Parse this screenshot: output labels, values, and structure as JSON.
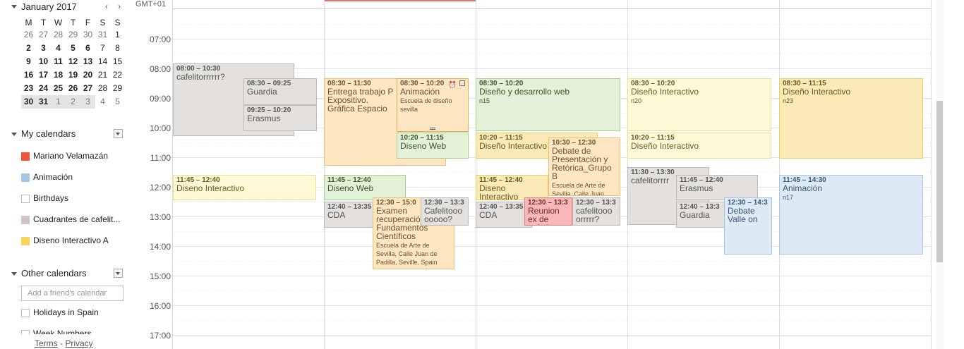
{
  "mini_calendar": {
    "month_label": "January 2017",
    "prev": "‹",
    "next": "›",
    "dow": [
      "M",
      "T",
      "W",
      "T",
      "F",
      "S",
      "S"
    ],
    "weeks": [
      [
        "26",
        "27",
        "28",
        "29",
        "30",
        "31",
        "1"
      ],
      [
        "2",
        "3",
        "4",
        "5",
        "6",
        "7",
        "8"
      ],
      [
        "9",
        "10",
        "11",
        "12",
        "13",
        "14",
        "15"
      ],
      [
        "16",
        "17",
        "18",
        "19",
        "20",
        "21",
        "22"
      ],
      [
        "23",
        "24",
        "25",
        "26",
        "27",
        "28",
        "29"
      ],
      [
        "30",
        "31",
        "1",
        "2",
        "3",
        "4",
        "5"
      ]
    ]
  },
  "my_calendars": {
    "label": "My calendars",
    "items": [
      {
        "name": "Mariano Velamazán",
        "color": "#f0543c"
      },
      {
        "name": "Animación",
        "color": "#a4c8ea"
      },
      {
        "name": "Birthdays",
        "color": ""
      },
      {
        "name": "Cuadrantes de cafelit...",
        "color": "#cfc4c4"
      },
      {
        "name": "Diseno Interactivo A",
        "color": "#f5d65b"
      }
    ]
  },
  "other_calendars": {
    "label": "Other calendars",
    "friend_placeholder": "Add a friend's calendar",
    "items": [
      {
        "name": "Holidays in Spain",
        "color": ""
      },
      {
        "name": "Week Numbers",
        "color": ""
      }
    ]
  },
  "footer": {
    "terms": "Terms",
    "sep": " - ",
    "privacy": "Privacy"
  },
  "grid": {
    "timezone": "GMT+01",
    "hours": [
      "07:00",
      "08:00",
      "09:00",
      "10:00",
      "11:00",
      "12:00",
      "13:00",
      "14:00",
      "15:00",
      "16:00",
      "17:00"
    ]
  },
  "events": {
    "mon": [
      {
        "time": "08:00 – 10:30",
        "title": "cafelitorrrrrr?",
        "sub": ""
      },
      {
        "time": "08:30 – 09:25",
        "title": "Guardia",
        "sub": ""
      },
      {
        "time": "09:25 – 10:20",
        "title": "Erasmus",
        "sub": ""
      },
      {
        "time": "11:45 – 12:40",
        "title": "Diseno Interactivo",
        "sub": ""
      }
    ],
    "tue": [
      {
        "time": "08:30 – 11:30",
        "title": "Entrega trabajo P Expositivo. Gráfica Espacio",
        "sub": ""
      },
      {
        "time": "08:30 – 10:20",
        "title": "Animación",
        "sub": "Escuela de diseño sevilla"
      },
      {
        "time": "10:20 – 11:15",
        "title": "Diseno Web",
        "sub": ""
      },
      {
        "time": "11:45 – 12:40",
        "title": "Diseno Web",
        "sub": ""
      },
      {
        "time": "12:40 – 13:35",
        "title": "CDA",
        "sub": ""
      },
      {
        "time": "12:30 – 15:0",
        "title": "Examen recuperació Fundamentos Científicos",
        "sub": "Escuela de Arte de Sevilla, Calle Juan de Padilla, Seville, Spain"
      },
      {
        "time": "12:30 – 13:3",
        "title": "Cafelitooo ooooo?",
        "sub": ""
      }
    ],
    "wed": [
      {
        "time": "08:30 – 10:20",
        "title": "Diseño y desarrollo web",
        "sub": "n15"
      },
      {
        "time": "10:20 – 11:15",
        "title": "Diseño Interactivo",
        "sub": ""
      },
      {
        "time": "10:30 – 12:30",
        "title": "Debate de Presentación y Retórica_Grupo B",
        "sub": "Escuela de Arte de Sevilla, Calle Juan"
      },
      {
        "time": "11:45 – 12:40",
        "title": "Diseno Interactivo",
        "sub": ""
      },
      {
        "time": "12:40 – 13:35",
        "title": "CDA",
        "sub": ""
      },
      {
        "time": "12:30 – 13:3",
        "title": "Reunion ex de práctica",
        "sub": ""
      },
      {
        "time": "12:30 – 13:3",
        "title": "cafelitooo orrrrr?",
        "sub": ""
      }
    ],
    "thu": [
      {
        "time": "08:30 – 10:20",
        "title": "Diseño Interactivo",
        "sub": "n20"
      },
      {
        "time": "10:20 – 11:15",
        "title": "Diseño Interactivo",
        "sub": ""
      },
      {
        "time": "11:30 – 13:30",
        "title": "cafelitorrrr",
        "sub": ""
      },
      {
        "time": "11:45 – 12:40",
        "title": "Erasmus",
        "sub": ""
      },
      {
        "time": "12:40 – 13:3",
        "title": "Guardia",
        "sub": ""
      },
      {
        "time": "12:30 – 14:3",
        "title": "Debate Valle on",
        "sub": ""
      }
    ],
    "fri": [
      {
        "time": "08:30 – 11:15",
        "title": "Diseño Interactivo",
        "sub": "n23"
      },
      {
        "time": "11:45 – 14:30",
        "title": "Animación",
        "sub": "n17"
      }
    ]
  }
}
